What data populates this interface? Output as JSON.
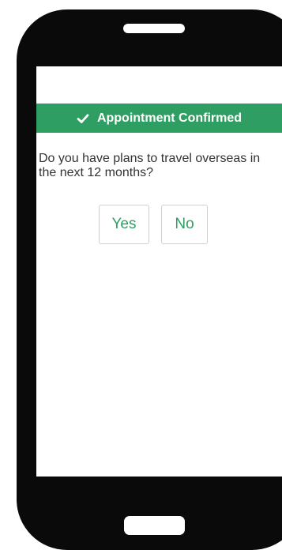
{
  "banner": {
    "icon": "check-icon",
    "text": "Appointment Confirmed",
    "color": "#2e9e63"
  },
  "question": {
    "text": "Do you have plans to travel overseas in the next 12 months?"
  },
  "answers": {
    "yes_label": "Yes",
    "no_label": "No",
    "label_color": "#2e9e63"
  },
  "device": {
    "frame_color": "#0a0a0a",
    "screen_color": "#ffffff"
  }
}
